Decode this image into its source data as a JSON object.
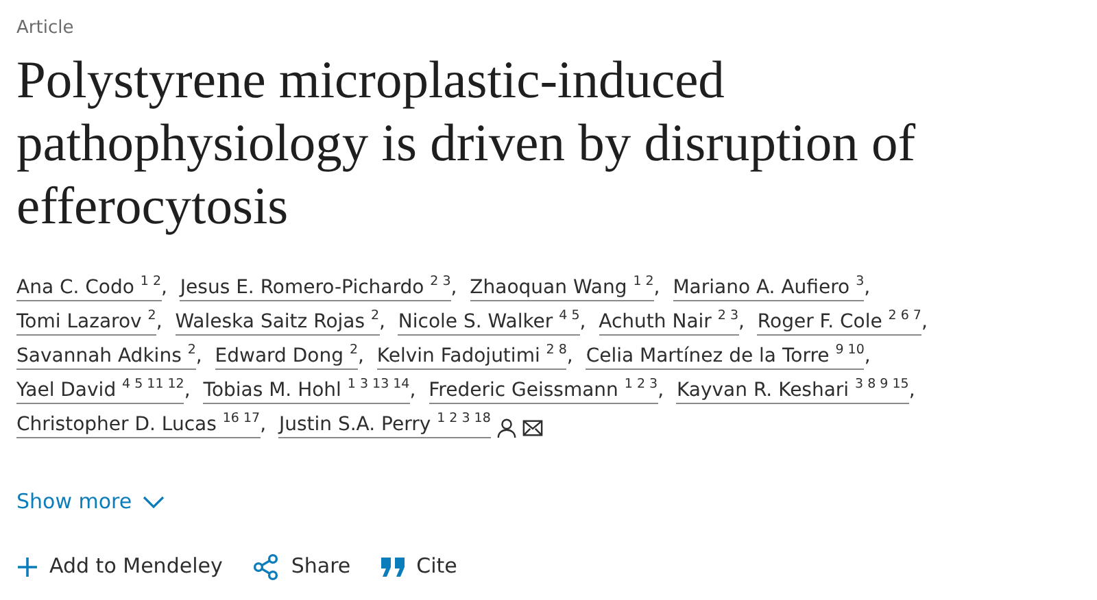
{
  "article_type": "Article",
  "title": "Polystyrene microplastic-induced pathophysiology is driven by disruption of efferocytosis",
  "authors": [
    {
      "name": "Ana C. Codo",
      "affiliations": "1 2",
      "separator": ","
    },
    {
      "name": "Jesus E. Romero-Pichardo",
      "affiliations": "2 3",
      "separator": ","
    },
    {
      "name": "Zhaoquan Wang",
      "affiliations": "1 2",
      "separator": ","
    },
    {
      "name": "Mariano A. Aufiero",
      "affiliations": "3",
      "separator": ","
    },
    {
      "name": "Tomi Lazarov",
      "affiliations": "2",
      "separator": ","
    },
    {
      "name": "Waleska Saitz Rojas",
      "affiliations": "2",
      "separator": ","
    },
    {
      "name": "Nicole S. Walker",
      "affiliations": "4 5",
      "separator": ","
    },
    {
      "name": "Achuth Nair",
      "affiliations": "2 3",
      "separator": ","
    },
    {
      "name": "Roger F. Cole",
      "affiliations": "2 6 7",
      "separator": ","
    },
    {
      "name": "Savannah Adkins",
      "affiliations": "2",
      "separator": ","
    },
    {
      "name": "Edward Dong",
      "affiliations": "2",
      "separator": ","
    },
    {
      "name": "Kelvin Fadojutimi",
      "affiliations": "2 8",
      "separator": ","
    },
    {
      "name": "Celia Martínez de la Torre",
      "affiliations": "9 10",
      "separator": ","
    },
    {
      "name": "Yael David",
      "affiliations": "4 5 11 12",
      "separator": ","
    },
    {
      "name": "Tobias M. Hohl",
      "affiliations": "1 3 13 14",
      "separator": ","
    },
    {
      "name": "Frederic Geissmann",
      "affiliations": "1 2 3",
      "separator": ","
    },
    {
      "name": "Kayvan R. Keshari",
      "affiliations": "3 8 9 15",
      "separator": ","
    },
    {
      "name": "Christopher D. Lucas",
      "affiliations": "16 17",
      "separator": ","
    },
    {
      "name": "Justin S.A. Perry",
      "affiliations": "1 2 3 18",
      "corresponding": true,
      "email": true
    }
  ],
  "show_more": {
    "label": "Show more"
  },
  "actions": [
    {
      "kind": "add",
      "label": "Add to Mendeley"
    },
    {
      "kind": "share",
      "label": "Share"
    },
    {
      "kind": "cite",
      "label": "Cite"
    }
  ]
}
